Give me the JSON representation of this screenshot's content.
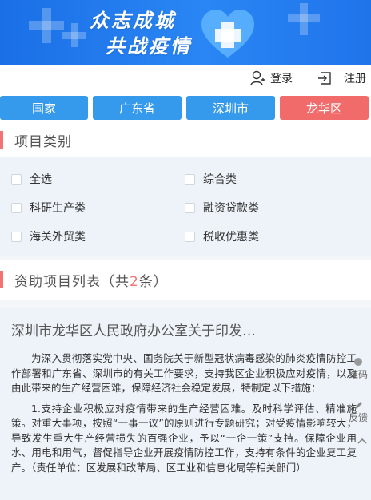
{
  "banner": {
    "line1": "众志成城",
    "line2": "共战疫情"
  },
  "auth": {
    "login": "登录",
    "register": "注册"
  },
  "regions": [
    {
      "label": "国家",
      "active": false
    },
    {
      "label": "广东省",
      "active": false
    },
    {
      "label": "深圳市",
      "active": false
    },
    {
      "label": "龙华区",
      "active": true
    }
  ],
  "categories_section": {
    "title": "项目类别",
    "items": [
      "全选",
      "综合类",
      "科研生产类",
      "融资贷款类",
      "海关外贸类",
      "税收优惠类"
    ]
  },
  "list_section": {
    "title_prefix": "资助项目列表（共",
    "count": "2",
    "title_suffix": "条）"
  },
  "article": {
    "title": "深圳市龙华区人民政府办公室关于印发…",
    "paragraphs": [
      "为深入贯彻落实党中央、国务院关于新型冠状病毒感染的肺炎疫情防控工作部署和广东省、深圳市的有关工作要求，支持我区企业积极应对疫情，以及由此带来的生产经营困难，保障经济社会稳定发展，特制定以下措施：",
      "1.支持企业积极应对疫情带来的生产经营困难。及时科学评估、精准施策。对重大事项，按照“一事一议”的原则进行专题研究；对受疫情影响较大，导致发生重大生产经营损失的百强企业，予以“一企一策”支持。保障企业用水、用电和用气，督促指导企业开展疫情防控工作，支持有条件的企业复工复产。（责任单位：区发展和改革局、区工业和信息化局等相关部门）"
    ]
  },
  "floating": {
    "qr": "维码",
    "feedback": "反馈"
  }
}
